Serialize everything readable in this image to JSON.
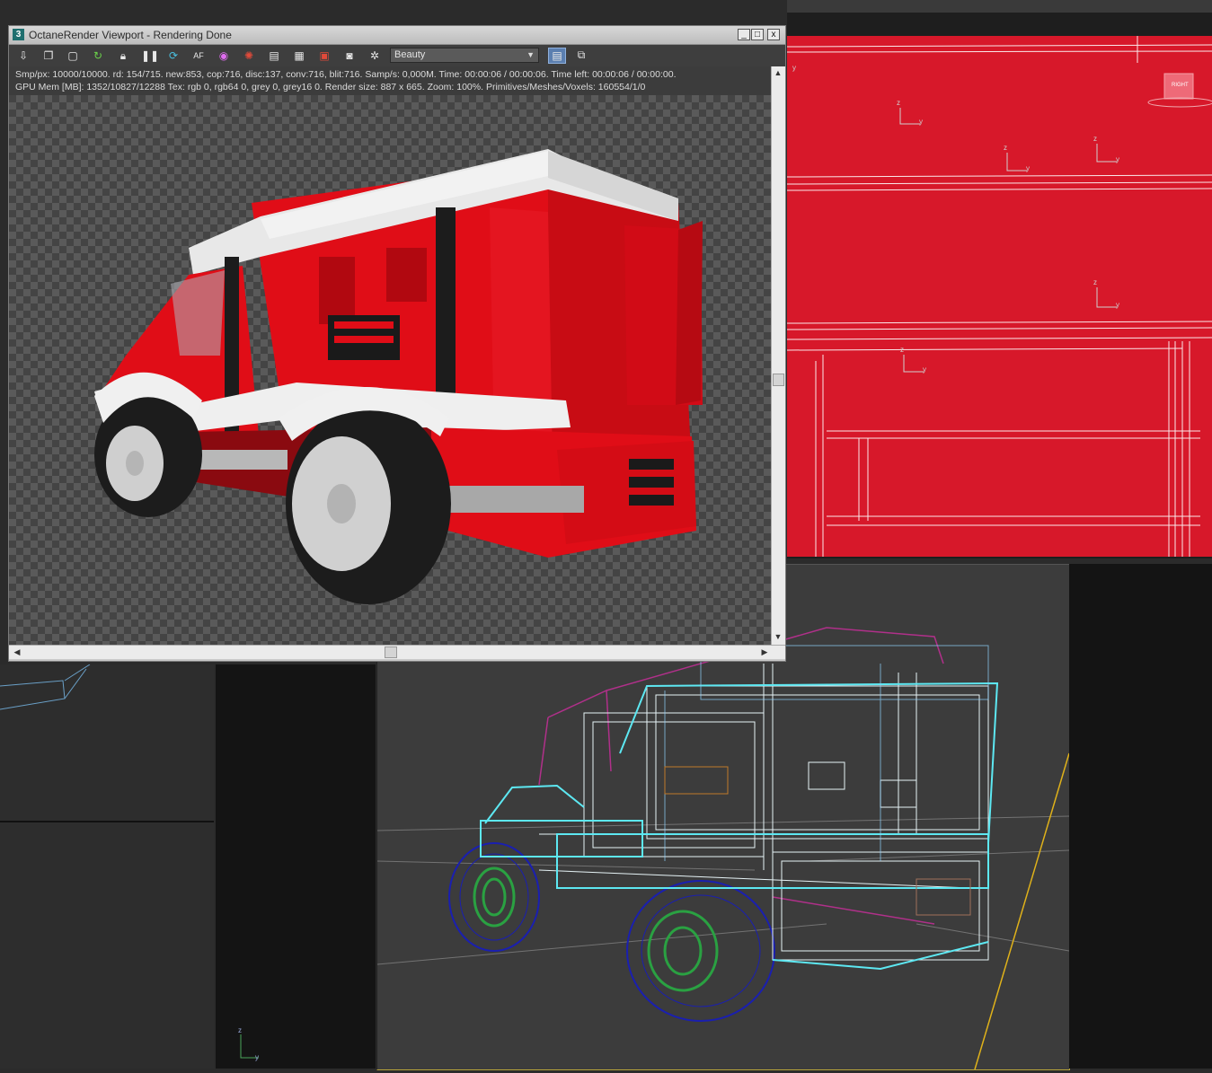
{
  "window": {
    "app_icon": "3",
    "title": "OctaneRender Viewport - Rendering Done",
    "controls": {
      "minimize": "_",
      "maximize": "□",
      "close": "x"
    }
  },
  "toolbar": {
    "icons": [
      "save-render-icon",
      "copy-icon",
      "zoom-region-icon",
      "restart-icon",
      "lock-icon",
      "pause-icon",
      "refresh-icon",
      "autofocus-icon",
      "color-picker-icon",
      "material-picker-icon",
      "render-region-icon",
      "film-region-icon",
      "camera-icon",
      "screenshot-icon",
      "settings-icon"
    ],
    "render_pass": "Beauty"
  },
  "status": {
    "line1": "Smp/px: 10000/10000.   rd: 154/715.   new:853, cop:716, disc:137, conv:716, blit:716.   Samp/s: 0,000M.   Time: 00:00:06 / 00:00:06.   Time left: 00:00:06 / 00:00:00.",
    "line2": "GPU Mem [MB]: 1352/10827/12288   Tex: rgb 0, rgb64 0, grey 0, grey16 0.   Render size: 887 x 665.   Zoom: 100%.   Primitives/Meshes/Voxels: 160554/1/0"
  },
  "viewports": {
    "right": {
      "view_cube_label": "RIGHT",
      "axis_label_z": "z",
      "axis_label_y": "y"
    },
    "bottom_left": {
      "axis_label_z": "z",
      "axis_label_y": "y"
    }
  },
  "colors": {
    "truck_red": "#e00d17",
    "viewport_red": "#d7182a",
    "wire_cyan": "#5de8f2",
    "wire_white": "#e6f3f6",
    "wire_magenta": "#b0308a",
    "wire_blue": "#1a1fb0",
    "wire_green": "#2aa142"
  }
}
